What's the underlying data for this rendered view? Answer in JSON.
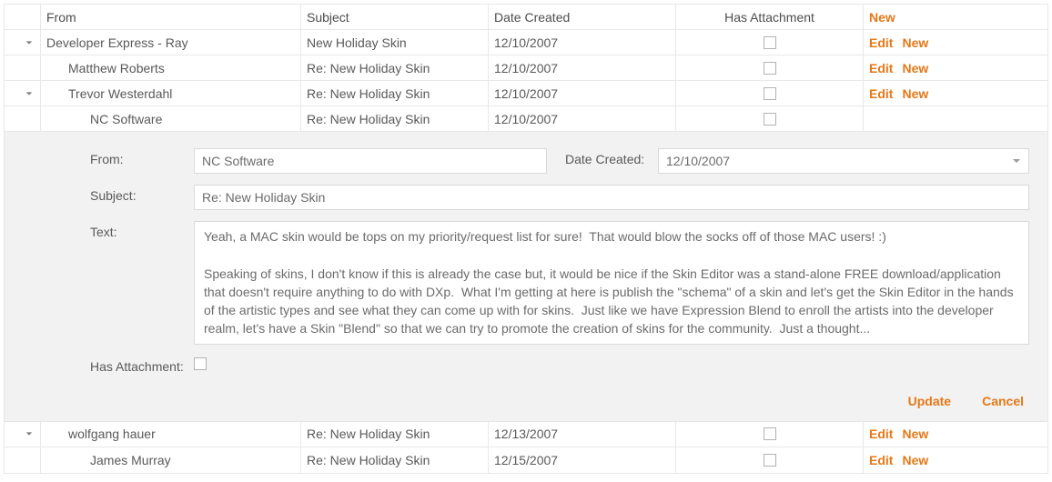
{
  "columns": {
    "from": "From",
    "subject": "Subject",
    "date": "Date Created",
    "attachment": "Has Attachment"
  },
  "commands": {
    "new": "New",
    "edit": "Edit",
    "row_new": "New",
    "update": "Update",
    "cancel": "Cancel"
  },
  "rows": {
    "r0": {
      "from": "Developer Express - Ray",
      "subject": "New Holiday Skin",
      "date": "12/10/2007"
    },
    "r1": {
      "from": "Matthew Roberts",
      "subject": "Re: New Holiday Skin",
      "date": "12/10/2007"
    },
    "r2": {
      "from": "Trevor Westerdahl",
      "subject": "Re: New Holiday Skin",
      "date": "12/10/2007"
    },
    "r3": {
      "from": "NC Software",
      "subject": "Re: New Holiday Skin",
      "date": "12/10/2007"
    },
    "r4": {
      "from": "wolfgang hauer",
      "subject": "Re: New Holiday Skin",
      "date": "12/13/2007"
    },
    "r5": {
      "from": "James Murray",
      "subject": "Re: New Holiday Skin",
      "date": "12/15/2007"
    }
  },
  "edit": {
    "labels": {
      "from": "From:",
      "date": "Date Created:",
      "subject": "Subject:",
      "text": "Text:",
      "attachment": "Has Attachment:"
    },
    "values": {
      "from": "NC Software",
      "date": "12/10/2007",
      "subject": "Re: New Holiday Skin",
      "text": "Yeah, a MAC skin would be tops on my priority/request list for sure!  That would blow the socks off of those MAC users! :)\n\nSpeaking of skins, I don't know if this is already the case but, it would be nice if the Skin Editor was a stand-alone FREE download/application that doesn't require anything to do with DXp.  What I'm getting at here is publish the \"schema\" of a skin and let's get the Skin Editor in the hands of the artistic types and see what they can come up with for skins.  Just like we have Expression Blend to enroll the artists into the developer realm, let's have a Skin \"Blend\" so that we can try to promote the creation of skins for the community.  Just a thought..."
    }
  }
}
